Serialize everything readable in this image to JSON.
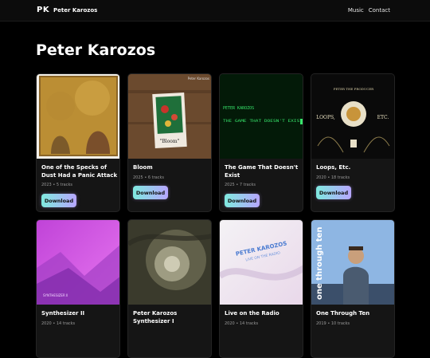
{
  "header": {
    "logo": "PK",
    "site_name": "Peter Karozos",
    "nav": [
      "Music",
      "Contact"
    ]
  },
  "page_title": "Peter Karozos",
  "albums": [
    {
      "title": "One of the Specks of Dust Had a Panic Attack",
      "meta": "2023 • 5 tracks",
      "download_label": "Download"
    },
    {
      "title": "Bloom",
      "meta": "2025 • 6 tracks",
      "download_label": "Download",
      "art_text": "\"Bloom\"",
      "art_corner": "Peter Karozos"
    },
    {
      "title": "The Game That Doesn't Exist",
      "meta": "2025 • 7 tracks",
      "download_label": "Download",
      "art_text1": "PETER KAROZOS",
      "art_text2": "THE GAME THAT DOESN'T EXIST"
    },
    {
      "title": "Loops, Etc.",
      "meta": "2020 • 18 tracks",
      "download_label": "Download",
      "art_top": "PETER THE PRODUCER",
      "art_left": "LOOPS,",
      "art_right": "ETC."
    },
    {
      "title": "Synthesizer II",
      "meta": "2020 • 14 tracks",
      "art_caption": "SYNTHESIZER II"
    },
    {
      "title": "Peter Karozos Synthesizer I",
      "meta": ""
    },
    {
      "title": "Live on the Radio",
      "meta": "2020 • 14 tracks",
      "art_text1": "PETER KAROZOS",
      "art_text2": "LIVE ON THE RADIO"
    },
    {
      "title": "One Through Ten",
      "meta": "2019 • 10 tracks",
      "art_text": "one through ten"
    }
  ]
}
